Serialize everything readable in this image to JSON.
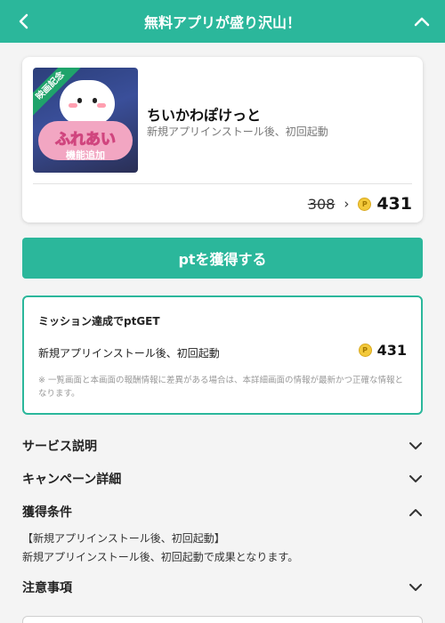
{
  "header": {
    "title": "無料アプリが盛り沢山！",
    "back_icon": "chevron-left-icon",
    "collapse_icon": "chevron-up-icon"
  },
  "app": {
    "thumb_ribbon": "映画記念",
    "thumb_main": "ふれあい",
    "thumb_sub": "機能追加",
    "name": "ちいかわぽけっと",
    "subtitle": "新規アプリインストール後、初回起動",
    "old_points": "308",
    "new_points": "431",
    "coin_icon": "P"
  },
  "cta": {
    "label": "ptを獲得する"
  },
  "mission": {
    "title": "ミッション達成でptGET",
    "desc": "新規アプリインストール後、初回起動",
    "points": "431",
    "note": "※ 一覧画面と本画面の報酬情報に差異がある場合は、本詳細画面の情報が最新かつ正確な情報となります。"
  },
  "sections": {
    "service": "サービス説明",
    "campaign": "キャンペーン詳細",
    "conditions": "獲得条件",
    "cond_line1": "【新規アプリインストール後、初回起動】",
    "cond_line2": "新規アプリインストール後、初回起動で成果となります。",
    "notes": "注意事項"
  },
  "colors": {
    "accent": "#2bb79b",
    "coin": "#f3c93b"
  }
}
